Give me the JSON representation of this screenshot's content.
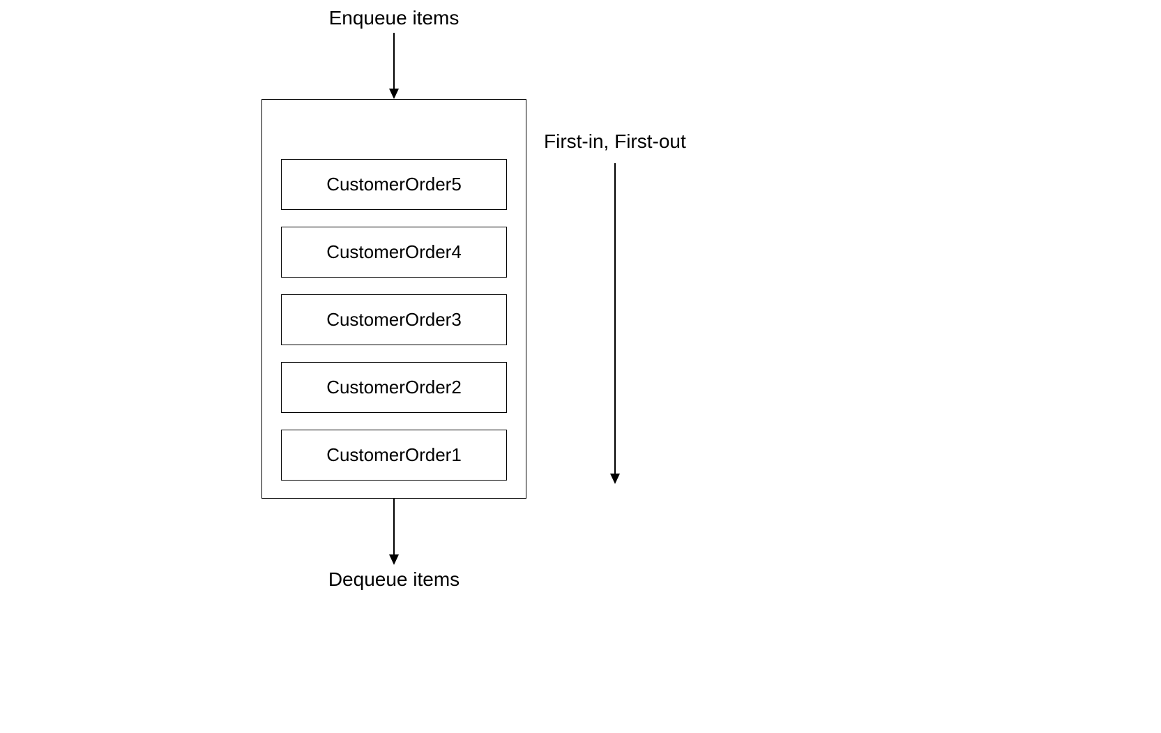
{
  "diagram": {
    "enqueue_label": "Enqueue items",
    "dequeue_label": "Dequeue items",
    "fifo_label": "First-in, First-out",
    "queue_items": [
      "CustomerOrder5",
      "CustomerOrder4",
      "CustomerOrder3",
      "CustomerOrder2",
      "CustomerOrder1"
    ]
  }
}
